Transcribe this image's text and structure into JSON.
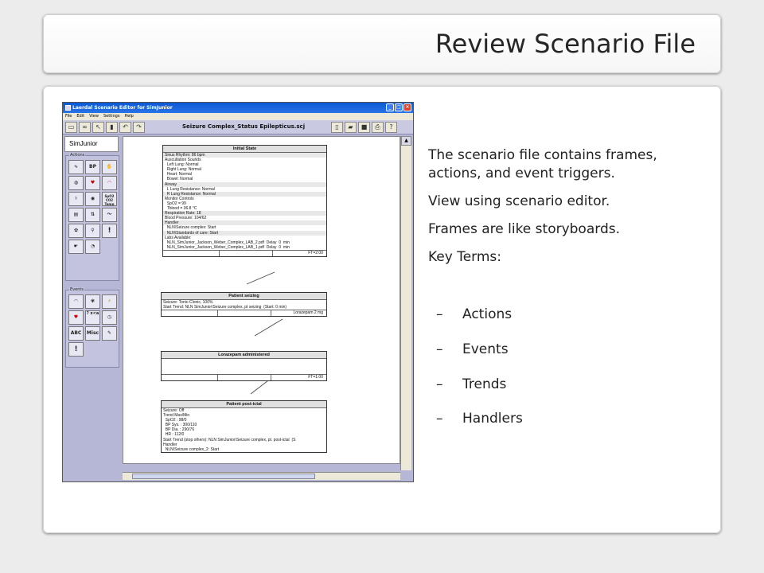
{
  "slide": {
    "title": "Review Scenario File",
    "paragraph1": [
      "The scenario file contains frames,",
      "actions, and event triggers."
    ],
    "paragraph2": "View using scenario editor.",
    "paragraph3": "Frames are like storyboards.",
    "paragraph4": "Key Terms:",
    "dash": "–",
    "key_terms": [
      "Actions",
      "Events",
      "Trends",
      "Handlers"
    ]
  },
  "app": {
    "window_title": "Laerdal Scenario Editor for SimJunior",
    "menu": [
      "File",
      "Edit",
      "View",
      "Settings",
      "Help"
    ],
    "scenario_title": "Seizure Complex_Status Epilepticus.scj",
    "sim_label": "SimJunior",
    "actions_label": "Actions",
    "events_label": "Events",
    "action_icons": [
      "heart-rhythm-icon",
      "BP",
      "hand-icon",
      "lungs-icon",
      "heart-icon",
      "lips-icon",
      "pulse-icon",
      "eye-icon",
      "SpO2 CO2 Temp",
      "blood-icon",
      "arrows-icon",
      "trend-icon",
      "settings-icon",
      "drops-icon",
      "!",
      "hand-2-icon",
      "skin-icon"
    ],
    "event_icons": [
      "shape-icon",
      "palette-icon",
      "lightning-icon",
      "heart-down-icon",
      "? x<a",
      "clock-icon",
      "ABC",
      "Misc",
      "pen-icon",
      "!"
    ],
    "frames": [
      {
        "title": "Initial State",
        "lines": [
          "Sinus Rhythm: 86 bpm",
          "Auscultation Sounds",
          "  Left Lung: Normal",
          "  Right Lung: Normal",
          "  Heart: Normal",
          "  Bowel: Normal",
          "Airway",
          "  L Lung Resistance: Normal",
          "  R Lung Resistance: Normal",
          "Monitor Controls",
          "  SpO2 = 99",
          "  Tblood = 36.8 °C",
          "Respiration Rate: 18",
          "Blood Pressure: 104/62",
          "Handler",
          "  NLN\\Seizure complex: Start",
          "  NLN\\Standards of care: Start",
          "Labs Available:",
          "  NLN_SimJunior_Jackson_Weber_Complex_LAB_2.pdf  Delay  0  min",
          "  NLN_SimJunior_Jackson_Weber_Complex_LAB_1.pdf  Delay  0  min"
        ],
        "footer": "FT=2:00"
      },
      {
        "title": "Patient seizing",
        "lines": [
          "Seizure: Tonic-Clonic, 100%",
          "Start Trend: NLN SimJunior\\Seizure complex, pt seizing  (Start: 0 min)"
        ],
        "footer": "Lorazepam 2 mg"
      },
      {
        "title": "Lorazepam administered",
        "lines": [],
        "footer": "FT=1:00"
      },
      {
        "title": "Patient post-ictal",
        "lines": [
          "Seizure: Off",
          "Trend Max/Min",
          "  SpO2 : 98/0",
          "  BP Sys. : 300/110",
          "  BP Dia. : 290/76",
          "  HR : 112/0",
          "Start Trend (stop others): NLN SimJunior\\Seizure complex, pt. post-ictal  (S",
          "Handler",
          "  NLN\\Seizure complex_2: Start"
        ],
        "footer": ""
      }
    ]
  },
  "colors": {
    "titlebar": "#0a58d4",
    "app_background": "#b6b6d6",
    "text": "#222222"
  }
}
